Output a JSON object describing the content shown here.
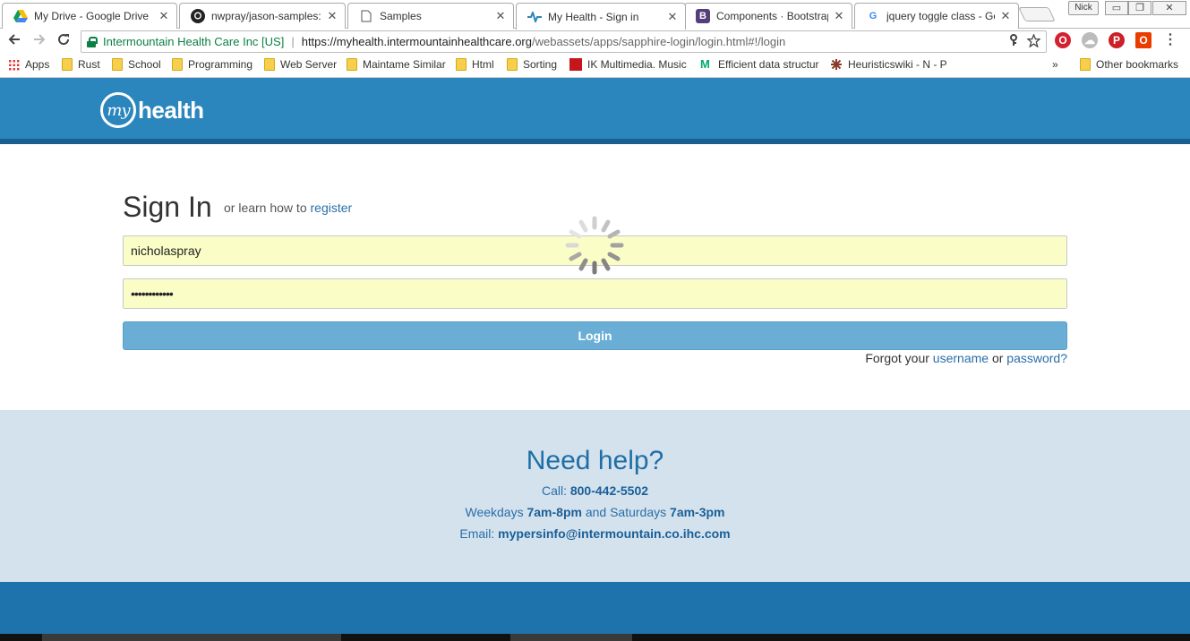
{
  "browser": {
    "tabs": [
      {
        "title": "My Drive - Google Drive",
        "icon": "google-drive-icon"
      },
      {
        "title": "nwpray/jason-samples: S",
        "icon": "github-icon"
      },
      {
        "title": "Samples",
        "icon": "document-icon"
      },
      {
        "title": "My Health - Sign in",
        "icon": "myhealth-icon",
        "active": true
      },
      {
        "title": "Components · Bootstrap",
        "icon": "bootstrap-icon"
      },
      {
        "title": "jquery toggle class - Goo",
        "icon": "google-icon"
      }
    ],
    "close_glyph": "✕",
    "profile_name": "Nick",
    "window_controls": {
      "minimize": "▭",
      "restore": "❐",
      "close": "✕"
    },
    "address": {
      "site_identity": "Intermountain Health Care Inc [US]",
      "separator": "|",
      "url_scheme_host": "https://myhealth.intermountainhealthcare.org",
      "url_path": "/webassets/apps/sapphire-login/login.html#!/login"
    },
    "bookmarks": [
      {
        "label": "Apps",
        "icon": "apps-grid-icon"
      },
      {
        "label": "Rust",
        "icon": "folder-icon"
      },
      {
        "label": "School",
        "icon": "folder-icon"
      },
      {
        "label": "Programming",
        "icon": "folder-icon"
      },
      {
        "label": "Web Server",
        "icon": "folder-icon"
      },
      {
        "label": "Maintame Similar",
        "icon": "folder-icon"
      },
      {
        "label": "Html",
        "icon": "folder-icon"
      },
      {
        "label": "Sorting",
        "icon": "folder-icon"
      },
      {
        "label": "IK Multimedia. Music",
        "icon": "ik-multimedia-icon"
      },
      {
        "label": "Efficient data structur",
        "icon": "medium-icon"
      },
      {
        "label": "Heuristicswiki - N - P",
        "icon": "heuristicswiki-icon"
      }
    ],
    "bookmarks_overflow": "»",
    "other_bookmarks": "Other bookmarks"
  },
  "page": {
    "logo_mark": "my",
    "logo_word": "health",
    "signin": {
      "title": "Sign In",
      "subtitle_prefix": "or learn how to",
      "register_link": "register"
    },
    "form": {
      "username_value": "nicholaspray",
      "password_value": "••••••••••••",
      "login_label": "Login",
      "forgot_prefix": "Forgot your",
      "forgot_username": "username",
      "forgot_or": "or",
      "forgot_password": "password?"
    },
    "loading_spinner": true,
    "help": {
      "title": "Need help?",
      "call_label": "Call:",
      "phone": "800-442-5502",
      "weekdays_label": "Weekdays",
      "weekdays_hours": "7am-8pm",
      "and_saturdays": "and Saturdays",
      "saturday_hours": "7am-3pm",
      "email_label": "Email:",
      "email": "mypersinfo@intermountain.co.ihc.com"
    }
  },
  "colors": {
    "header_blue": "#2a86bd",
    "header_border": "#1a5f8e",
    "help_bg": "#d4e2ee",
    "footer_blue": "#1e73ad",
    "login_button": "#6aaed6",
    "autofill_yellow": "#fafdc6",
    "link_blue": "#2a6ea8"
  }
}
